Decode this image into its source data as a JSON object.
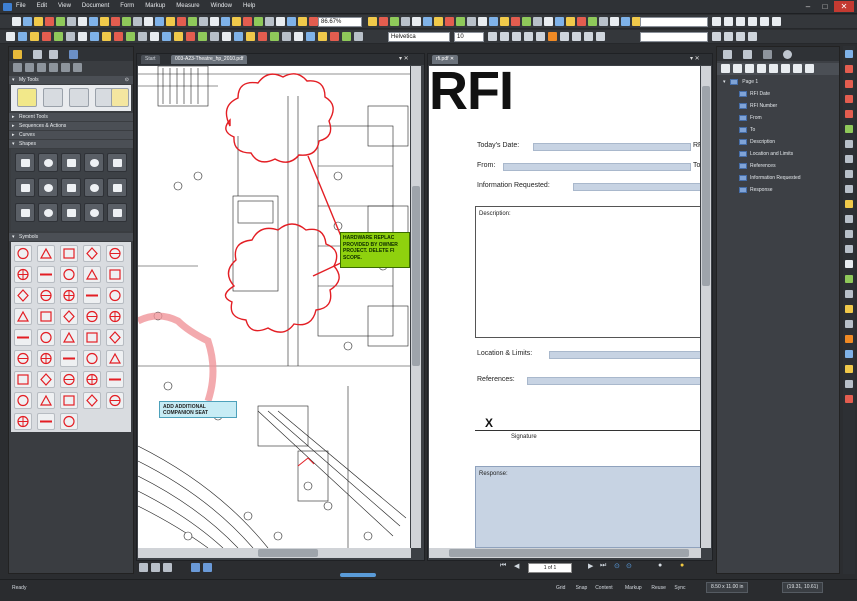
{
  "menu": [
    "File",
    "Edit",
    "View",
    "Document",
    "Form",
    "Markup",
    "Measure",
    "Window",
    "Help"
  ],
  "toolbar": {
    "zoom": "86.67%",
    "font": "Helvetica",
    "font_size": "10"
  },
  "left_panel": {
    "sections": [
      {
        "label": "My Tools"
      },
      {
        "label": "Recent Tools"
      },
      {
        "label": "Sequences & Actions"
      },
      {
        "label": "Curves"
      },
      {
        "label": "Shapes"
      },
      {
        "label": "Symbols"
      }
    ]
  },
  "left_doc": {
    "tabs": [
      "Start",
      "003-A23-Theatre_hp_2010.pdf"
    ],
    "callouts": [
      {
        "text": "HARDWARE REPLAC PROVIDED BY OWNER PROJECT. DELETE FI SCOPE."
      },
      {
        "text": "ADD ADDITIONAL COMPANION SEAT"
      }
    ]
  },
  "right_doc": {
    "tab": "rfi.pdf",
    "heading": "RFI",
    "fields": {
      "date_label": "Today's Date:",
      "date_suffix": "RF",
      "from_label": "From:",
      "from_suffix": "To",
      "info_label": "Information Requested:",
      "description_label": "Description:",
      "location_label": "Location & Limits:",
      "references_label": "References:",
      "x_mark": "X",
      "signature_label": "Signature",
      "response_label": "Response:"
    },
    "page_nav": "1 of 1"
  },
  "right_panel": {
    "root": "Page 1",
    "items": [
      "RFI Date",
      "RFI Number",
      "From",
      "To",
      "Description",
      "Location and Limits",
      "References",
      "Information Requested",
      "Response"
    ]
  },
  "status": {
    "ready": "Ready",
    "toggles": [
      "Grid",
      "Snap",
      "Content",
      "Markup",
      "Reuse",
      "Sync"
    ],
    "page_size": "8.50 x 11.00 in",
    "coords": "(19.31, 10.61)"
  },
  "colors": {
    "accent_red": "#e31e24",
    "callout_green": "#8fd10e",
    "callout_blue": "#c7ecf5",
    "field_blue": "#c7d3e3"
  }
}
